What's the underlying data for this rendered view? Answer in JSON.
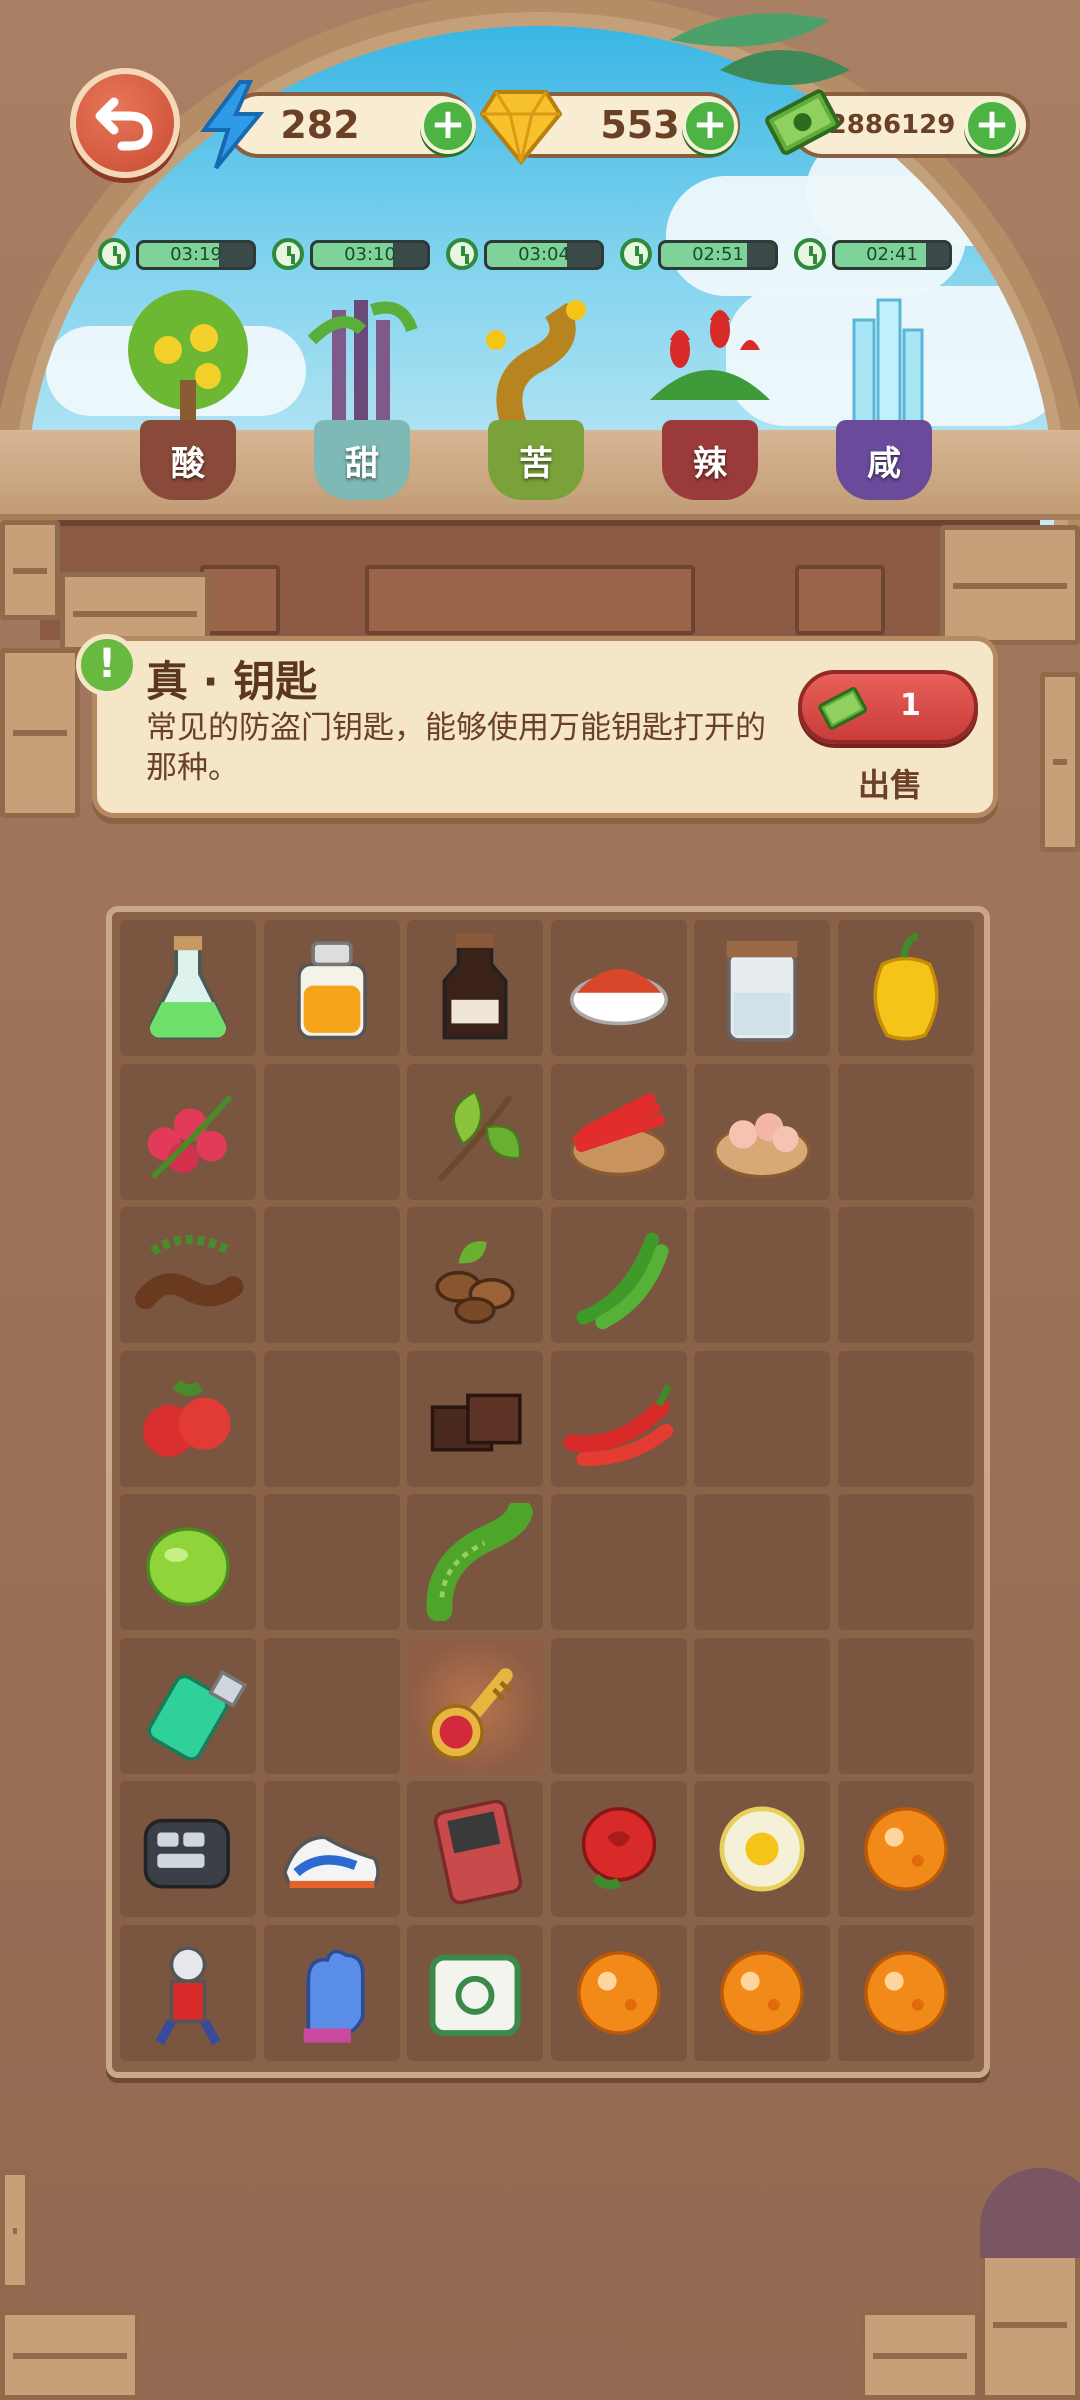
{
  "currencies": {
    "energy": {
      "value": "282",
      "icon": "lightning-icon"
    },
    "gems": {
      "value": "553",
      "icon": "gem-icon"
    },
    "cash": {
      "value": "2886129",
      "icon": "cash-icon"
    }
  },
  "plants": [
    {
      "timer": "03:19",
      "flavor": "酸",
      "progress": 0.7
    },
    {
      "timer": "03:10",
      "flavor": "甜",
      "progress": 0.7
    },
    {
      "timer": "03:04",
      "flavor": "苦",
      "progress": 0.7
    },
    {
      "timer": "02:51",
      "flavor": "辣",
      "progress": 0.75
    },
    {
      "timer": "02:41",
      "flavor": "咸",
      "progress": 0.8
    }
  ],
  "selected_item": {
    "name": "真 · 钥匙",
    "description": "常见的防盗门钥匙，能够使用万能钥匙打开的那种。",
    "sell_price": "1",
    "sell_label": "出售"
  },
  "grid": {
    "rows": [
      [
        "green-potion-icon",
        "orange-jar-icon",
        "soy-sauce-bottle-icon",
        "chili-powder-bowl-icon",
        "salt-jar-icon",
        "yellow-pepper-icon"
      ],
      [
        "raspberry-branch-icon",
        "",
        "tea-leaves-icon",
        "red-chili-bowl-icon",
        "shrimp-bowl-icon",
        ""
      ],
      [
        "tamarind-icon",
        "",
        "coffee-beans-icon",
        "green-chili-icon",
        "",
        ""
      ],
      [
        "hawthorn-icon",
        "",
        "chocolate-icon",
        "red-chili-icon",
        "",
        ""
      ],
      [
        "lime-icon",
        "",
        "bitter-melon-icon",
        "",
        "",
        ""
      ],
      [
        "lighter-icon",
        "",
        "key-icon",
        "",
        "",
        ""
      ],
      [
        "car-key-icon",
        "sneaker-icon",
        "game-console-icon",
        "rose-icon",
        "fried-egg-icon",
        "orange-orb-icon"
      ],
      [
        "hero-figure-icon",
        "blue-glove-icon",
        "mahjong-tile-icon",
        "orange-orb-icon",
        "orange-orb-icon",
        "orange-orb-icon"
      ]
    ],
    "selected": [
      5,
      2
    ]
  }
}
